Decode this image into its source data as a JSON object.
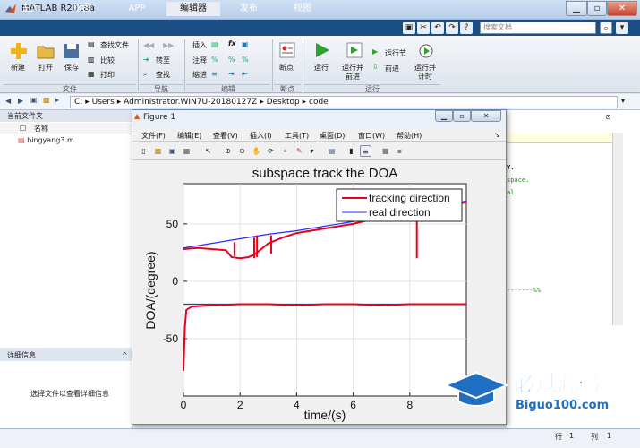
{
  "app": {
    "title": "MATLAB R2018a"
  },
  "window_controls": {
    "minimize": "▁",
    "maximize": "▫",
    "close": "✕"
  },
  "tabs": [
    "主页",
    "绘图",
    "APP",
    "编辑器",
    "发布",
    "视图"
  ],
  "search": {
    "placeholder": "搜索文档"
  },
  "ribbon": {
    "file": {
      "new": "新建",
      "open": "打开",
      "save": "保存",
      "find_files": "查找文件",
      "compare": "比较",
      "print": "打印",
      "section": "文件"
    },
    "nav": {
      "goto": "转至",
      "find": "查找",
      "section": "导航"
    },
    "edit": {
      "insert": "插入",
      "comment": "注释",
      "indent": "缩进",
      "section": "编辑"
    },
    "breakpoints": {
      "label": "断点",
      "section": "断点"
    },
    "run": {
      "run": "运行",
      "run_advance": [
        "运行并",
        "前进"
      ],
      "run_section": "运行节",
      "advance": "前进",
      "run_time": [
        "运行并",
        "计时"
      ],
      "section": "运行"
    }
  },
  "address": {
    "parts": [
      "C:",
      "Users",
      "Administrator.WIN7U-20180127Z",
      "Desktop",
      "code"
    ],
    "seps": [
      "▸",
      "▸",
      "▸",
      "▸"
    ]
  },
  "current_folder": {
    "title": "当前文件夹",
    "column": "名称",
    "files": [
      "bingyang3.m"
    ]
  },
  "details": {
    "title": "详细信息",
    "empty_text": "选择文件以查看详细信息"
  },
  "editor": {
    "lines": [
      "Y.",
      "space.",
      "al",
      "-------%%"
    ]
  },
  "status": {
    "row_label": "行",
    "row": "1",
    "col_label": "列",
    "col": "1"
  },
  "figure": {
    "title": "Figure 1",
    "menu": [
      "文件(F)",
      "编辑(E)",
      "查看(V)",
      "插入(I)",
      "工具(T)",
      "桌面(D)",
      "窗口(W)",
      "帮助(H)"
    ]
  },
  "chart_data": {
    "type": "line",
    "title": "subspace track the DOA",
    "xlabel": "time/(s)",
    "ylabel": "DOA/(degree)",
    "xlim": [
      0,
      10
    ],
    "ylim": [
      -100,
      85
    ],
    "xticks": [
      0,
      2,
      4,
      6,
      8
    ],
    "yticks": [
      -50,
      0,
      50
    ],
    "grid": true,
    "legend": {
      "placement": "top-right",
      "entries": [
        "tracking direction",
        "real direction"
      ]
    },
    "colors": {
      "tracking": "#e8001c",
      "real": "#2a2aff"
    },
    "series": [
      {
        "name": "real direction",
        "x": [
          0,
          1,
          2,
          3,
          4,
          5,
          6,
          7,
          8,
          9,
          10
        ],
        "y": [
          29,
          33,
          37,
          41,
          44,
          48,
          52,
          56,
          60,
          64,
          70
        ]
      },
      {
        "name": "tracking direction",
        "x": [
          0,
          0.5,
          1,
          1.5,
          1.7,
          2,
          2.3,
          2.5,
          3,
          3.5,
          4,
          5,
          6,
          6.5,
          7,
          7.5,
          8,
          8.5,
          9,
          9.5,
          10
        ],
        "y": [
          28,
          29,
          28,
          27,
          21,
          20,
          21,
          23,
          33,
          38,
          42,
          46,
          50,
          53,
          55,
          57,
          60,
          63,
          64,
          66,
          69
        ]
      },
      {
        "name": "real direction",
        "x": [
          0,
          10
        ],
        "y": [
          -20,
          -20
        ]
      },
      {
        "name": "tracking direction",
        "x": [
          0,
          0.05,
          0.1,
          0.3,
          1,
          2,
          3,
          4,
          5,
          6,
          7,
          8,
          9,
          10
        ],
        "y": [
          -78,
          -40,
          -25,
          -22,
          -21,
          -20,
          -20,
          -21,
          -20,
          -20,
          -21,
          -20,
          -20,
          -20
        ]
      }
    ],
    "spikes": [
      {
        "x": 1.8,
        "y0": 22,
        "y1": 34
      },
      {
        "x": 2.5,
        "y0": 20,
        "y1": 38
      },
      {
        "x": 2.6,
        "y0": 21,
        "y1": 40
      },
      {
        "x": 3.1,
        "y0": 24,
        "y1": 40
      },
      {
        "x": 8.25,
        "y0": 20,
        "y1": 58
      }
    ]
  },
  "watermark": {
    "text": "必过源码",
    "url": "Biguo100.com"
  }
}
